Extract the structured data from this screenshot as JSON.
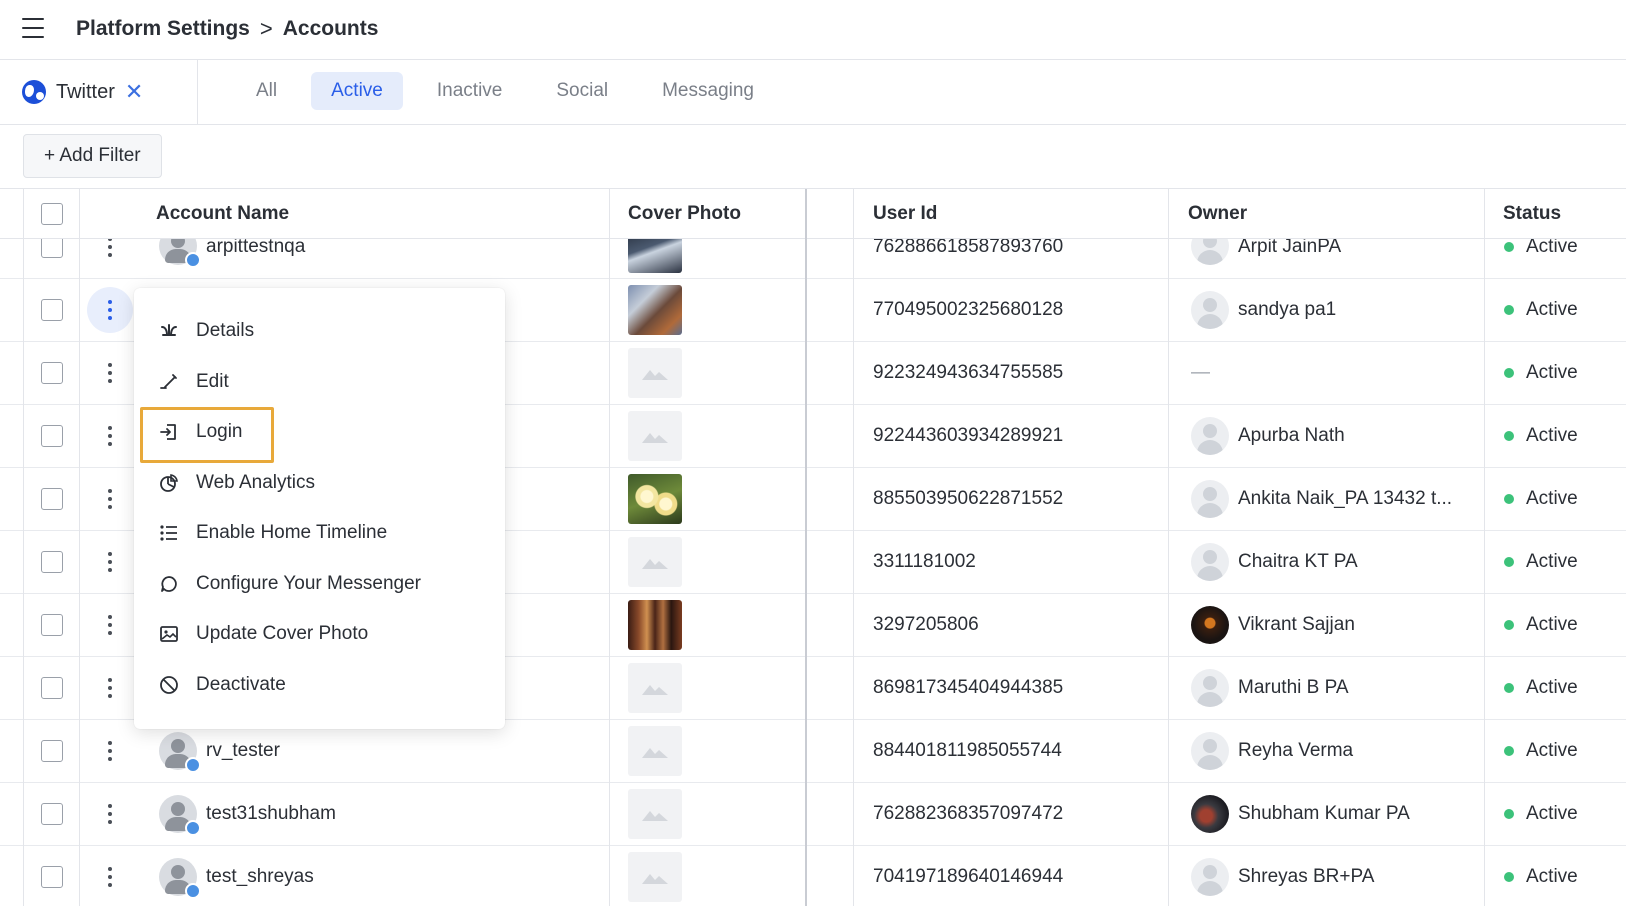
{
  "header": {
    "breadcrumb_root": "Platform Settings",
    "breadcrumb_sep": ">",
    "breadcrumb_current": "Accounts"
  },
  "channel_filter": {
    "label": "Twitter",
    "remove_glyph": "✕"
  },
  "tabs": [
    {
      "label": "All",
      "active": false
    },
    {
      "label": "Active",
      "active": true
    },
    {
      "label": "Inactive",
      "active": false
    },
    {
      "label": "Social",
      "active": false
    },
    {
      "label": "Messaging",
      "active": false
    }
  ],
  "add_filter_label": "+ Add Filter",
  "table": {
    "columns": [
      "Account Name",
      "Cover Photo",
      "User Id",
      "Owner",
      "Status"
    ],
    "rows": [
      {
        "account": "arpittestnqa",
        "user_id": "762886618587893760",
        "owner": "Arpit JainPA",
        "status": "Active"
      },
      {
        "account": "",
        "user_id": "770495002325680128",
        "owner": "sandya pa1",
        "status": "Active"
      },
      {
        "account": "",
        "user_id": "922324943634755585",
        "owner": "—",
        "status": "Active"
      },
      {
        "account": "",
        "user_id": "922443603934289921",
        "owner": "Apurba Nath",
        "status": "Active"
      },
      {
        "account": "",
        "user_id": "885503950622871552",
        "owner": "Ankita Naik_PA 13432 t...",
        "status": "Active"
      },
      {
        "account": "",
        "user_id": "3311181002",
        "owner": "Chaitra KT PA",
        "status": "Active"
      },
      {
        "account": "",
        "user_id": "3297205806",
        "owner": "Vikrant Sajjan",
        "status": "Active"
      },
      {
        "account": "",
        "user_id": "869817345404944385",
        "owner": "Maruthi B PA",
        "status": "Active"
      },
      {
        "account": "rv_tester",
        "user_id": "884401811985055744",
        "owner": "Reyha Verma",
        "status": "Active"
      },
      {
        "account": "test31shubham",
        "user_id": "762882368357097472",
        "owner": "Shubham Kumar PA",
        "status": "Active"
      },
      {
        "account": "test_shreyas",
        "user_id": "704197189640146944",
        "owner": "Shreyas BR+PA",
        "status": "Active"
      }
    ]
  },
  "context_menu": {
    "items": [
      {
        "label": "Details",
        "icon": "details-icon"
      },
      {
        "label": "Edit",
        "icon": "pencil-icon"
      },
      {
        "label": "Login",
        "icon": "login-icon",
        "highlighted": true
      },
      {
        "label": "Web Analytics",
        "icon": "pie-chart-icon"
      },
      {
        "label": "Enable Home Timeline",
        "icon": "list-icon"
      },
      {
        "label": "Configure Your Messenger",
        "icon": "chat-bubble-icon"
      },
      {
        "label": "Update Cover Photo",
        "icon": "image-icon"
      },
      {
        "label": "Deactivate",
        "icon": "block-icon"
      }
    ]
  },
  "colors": {
    "accent": "#2a5ee8",
    "active_tab_bg": "#e5ecfb",
    "status_active": "#3cc27a",
    "highlight_border": "#e8a93a"
  }
}
